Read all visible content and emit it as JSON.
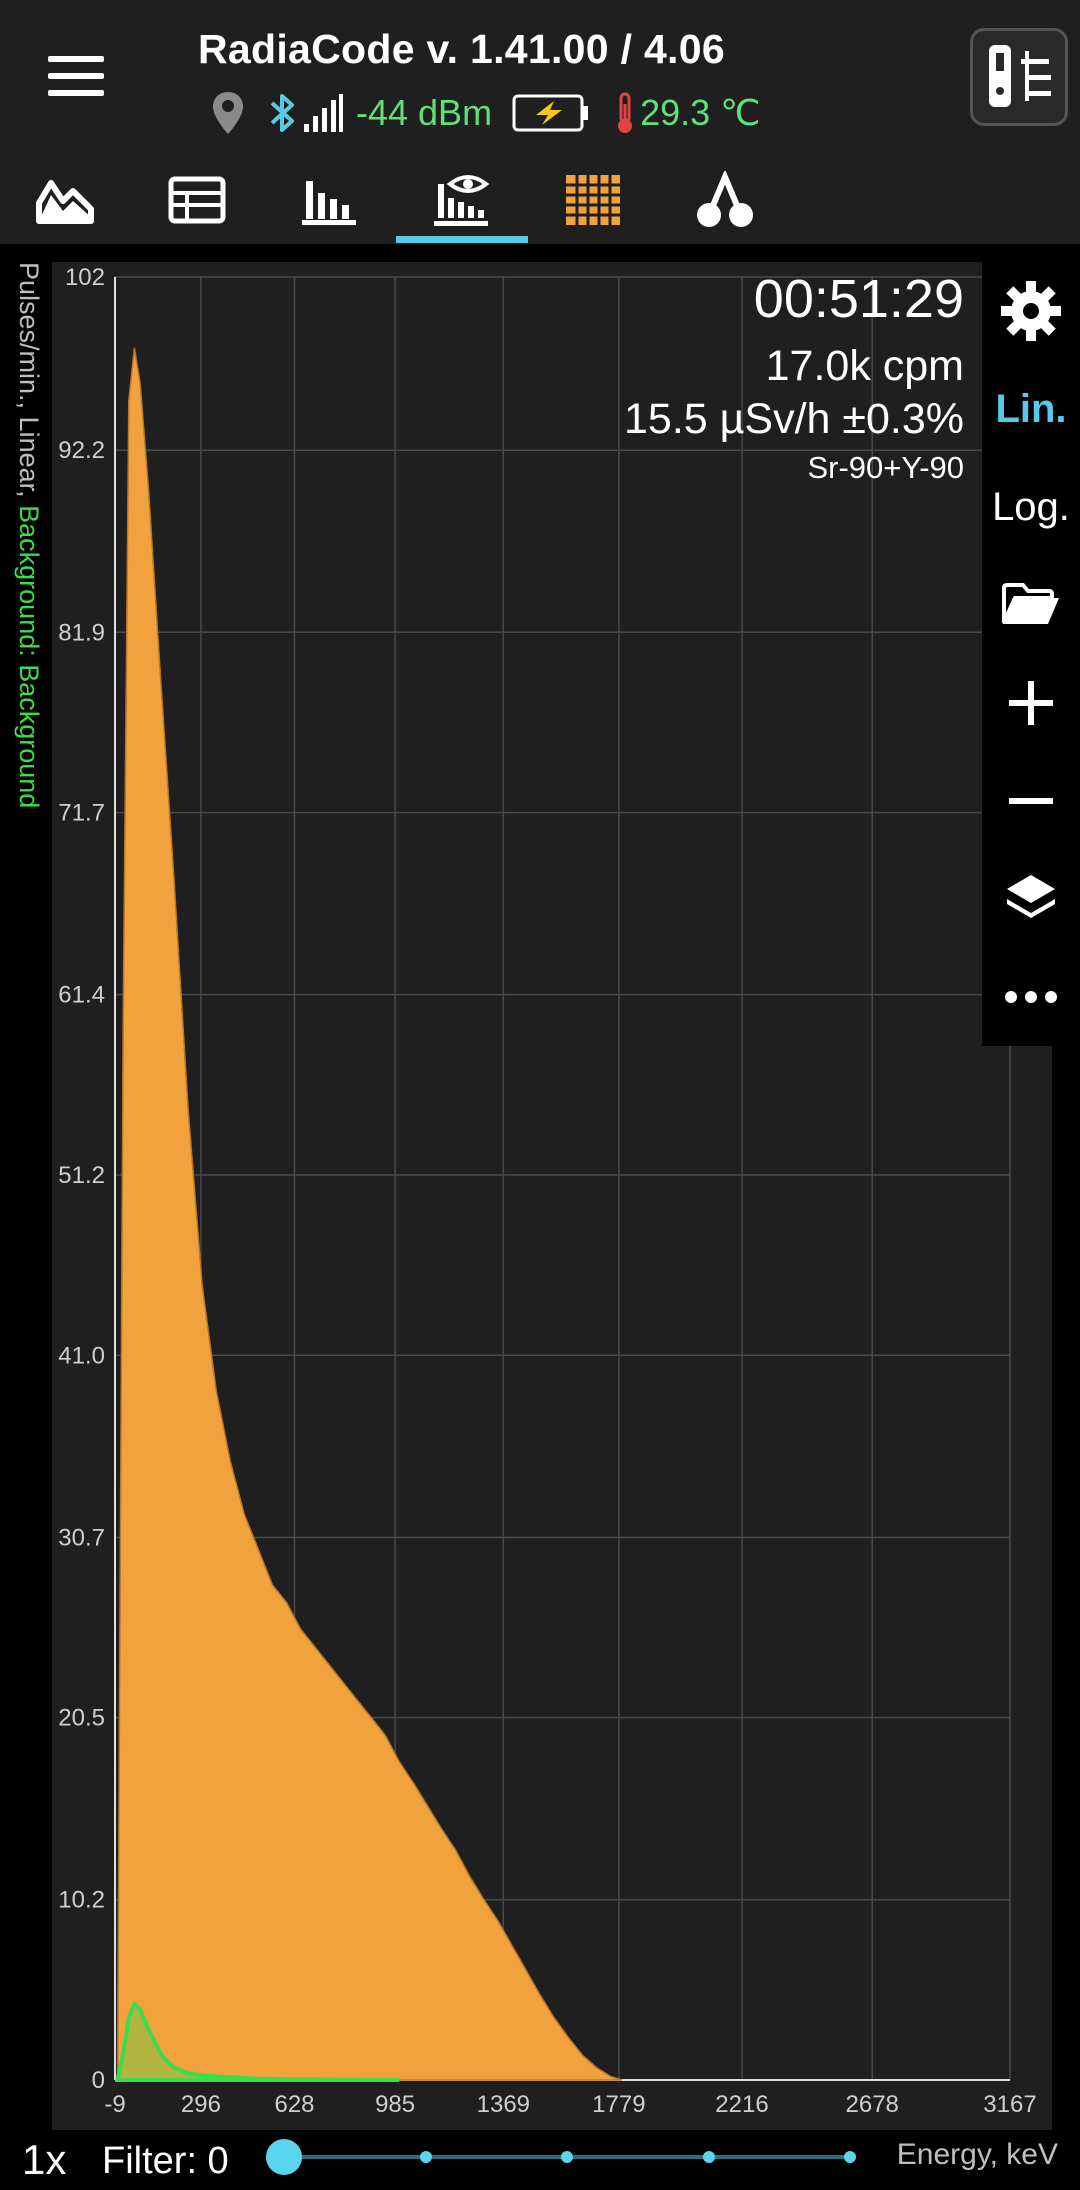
{
  "header": {
    "title": "RadiaCode v. 1.41.00 / 4.06",
    "signal": "-44 dBm",
    "temperature": "29.3 ℃"
  },
  "tabs": [
    {
      "name": "dose-rate-chart"
    },
    {
      "name": "table"
    },
    {
      "name": "spectrum-histogram"
    },
    {
      "name": "spectrum",
      "active": true
    },
    {
      "name": "grid"
    },
    {
      "name": "isotopes"
    }
  ],
  "overlay": {
    "timer": "00:51:29",
    "cpm": "17.0k cpm",
    "dose": "15.5 µSv/h ±0.3%",
    "isotope": "Sr-90+Y-90"
  },
  "y_axis_label": {
    "prefix": "Pulses/min., Linear, ",
    "background": "Background: Background"
  },
  "side_toolbar": {
    "lin": "Lin.",
    "log": "Log."
  },
  "bottom": {
    "zoom": "1x",
    "filter": "Filter: 0",
    "energy_label": "Energy, keV"
  },
  "colors": {
    "spectrum": "#f2a23c",
    "background": "#3ddc4a",
    "accent": "#5bc8e6",
    "status_green": "#5fe07a"
  },
  "chart_data": {
    "type": "area",
    "xlabel": "Energy, keV",
    "ylabel": "Pulses/min., Linear",
    "y_ticks": [
      "0",
      "10.2",
      "20.5",
      "30.7",
      "41.0",
      "51.2",
      "61.4",
      "71.7",
      "81.9",
      "92.2",
      "102"
    ],
    "x_ticks": [
      "-9",
      "296",
      "628",
      "985",
      "1369",
      "1779",
      "2216",
      "2678",
      "3167"
    ],
    "ylim": [
      0,
      102
    ],
    "xlim": [
      -9,
      3167
    ],
    "grid": true,
    "series": [
      {
        "name": "Sr-90+Y-90",
        "color": "#f2a23c",
        "x": [
          0,
          20,
          40,
          60,
          80,
          110,
          150,
          200,
          250,
          300,
          350,
          400,
          450,
          500,
          550,
          600,
          650,
          700,
          750,
          800,
          850,
          900,
          950,
          1000,
          1050,
          1100,
          1150,
          1200,
          1250,
          1300,
          1350,
          1400,
          1450,
          1500,
          1550,
          1600,
          1650,
          1700,
          1750,
          1790
        ],
        "values": [
          0,
          60,
          95,
          98,
          96,
          90,
          80,
          68,
          55,
          45,
          39,
          35,
          32,
          30,
          28,
          27,
          25.5,
          24.5,
          23.5,
          22.5,
          21.5,
          20.5,
          19.5,
          18,
          16.8,
          15.5,
          14.2,
          13,
          11.5,
          10.2,
          9,
          7.6,
          6.2,
          4.8,
          3.5,
          2.4,
          1.4,
          0.7,
          0.2,
          0
        ]
      },
      {
        "name": "Background",
        "color": "#3ddc4a",
        "x": [
          0,
          20,
          40,
          60,
          80,
          100,
          130,
          160,
          200,
          250,
          300,
          400,
          500,
          700,
          1000
        ],
        "values": [
          0,
          1.5,
          3.5,
          4.3,
          4.0,
          3.2,
          2.2,
          1.3,
          0.7,
          0.4,
          0.25,
          0.15,
          0.08,
          0.03,
          0
        ]
      }
    ]
  }
}
